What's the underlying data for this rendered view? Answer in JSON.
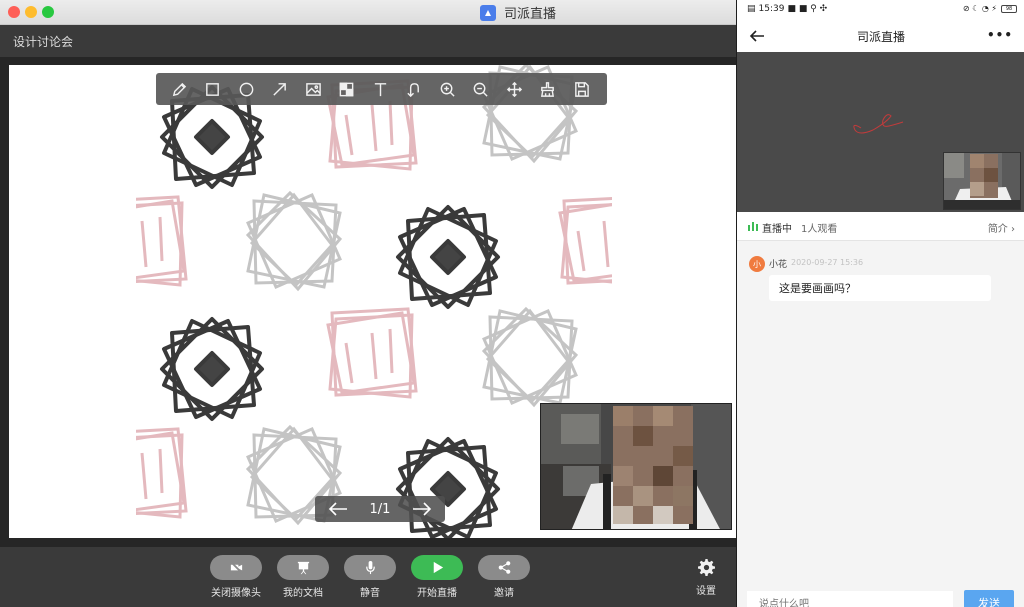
{
  "window": {
    "app_title": "司派直播",
    "meeting_name": "设计讨论会"
  },
  "whiteboard": {
    "tools": [
      {
        "name": "pencil-icon"
      },
      {
        "name": "rectangle-icon"
      },
      {
        "name": "circle-icon"
      },
      {
        "name": "arrow-icon"
      },
      {
        "name": "image-icon"
      },
      {
        "name": "mosaic-icon"
      },
      {
        "name": "text-icon"
      },
      {
        "name": "undo-icon"
      },
      {
        "name": "zoom-in-icon"
      },
      {
        "name": "zoom-out-icon"
      },
      {
        "name": "move-icon"
      },
      {
        "name": "clear-icon"
      },
      {
        "name": "save-icon"
      }
    ],
    "pager": {
      "page": "1/1"
    }
  },
  "controls": {
    "camera_off": "关闭摄像头",
    "my_docs": "我的文档",
    "mute": "静音",
    "start_live": "开始直播",
    "invite": "邀请",
    "settings": "设置"
  },
  "phone": {
    "status": {
      "time": "15:39",
      "battery": "98"
    },
    "nav_title": "司派直播",
    "more": "•••",
    "live_status": "直播中",
    "viewers": "1人观看",
    "intro": "简介 ›",
    "message": {
      "avatar": "小",
      "user": "小花",
      "time": "2020-09-27  15:36",
      "text": "这是要画画吗？"
    },
    "input_placeholder": "说点什么吧",
    "send": "发送"
  },
  "colors": {
    "start_live_green": "#3dbb55",
    "send_blue": "#5aa6f0",
    "close": "#fe5f57",
    "minimize": "#febc2e",
    "maximize": "#28c840"
  }
}
